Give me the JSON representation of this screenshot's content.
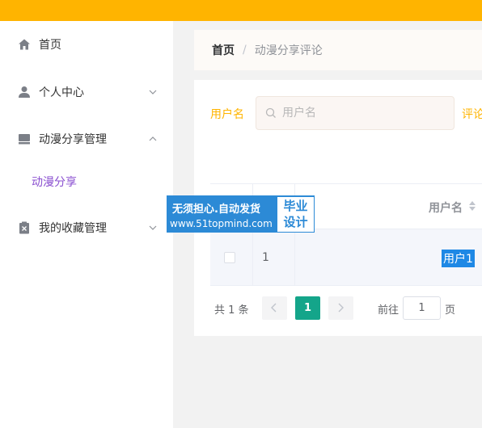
{
  "sidebar": {
    "items": [
      {
        "label": "首页",
        "icon": "home-icon"
      },
      {
        "label": "个人中心",
        "icon": "user-icon",
        "arrow": "chevron-down-icon"
      },
      {
        "label": "动漫分享管理",
        "icon": "inbox-icon",
        "arrow": "chevron-up-icon"
      },
      {
        "label": "我的收藏管理",
        "icon": "clipboard-icon",
        "arrow": "chevron-down-icon"
      }
    ],
    "submenu": {
      "label": "动漫分享"
    }
  },
  "breadcrumb": {
    "home": "首页",
    "separator": "/",
    "current": "动漫分享评论"
  },
  "filter": {
    "label": "用户名",
    "placeholder": "用户名",
    "next_label": "评论"
  },
  "table": {
    "header": {
      "username": "用户名"
    },
    "rows": [
      {
        "index": "1",
        "username": "用户1"
      }
    ]
  },
  "pagination": {
    "total": "共 1 条",
    "current_page": "1",
    "goto_label": "前往",
    "goto_value": "1",
    "page_suffix": "页"
  },
  "watermark": {
    "line1": "无须担心.自动发货",
    "line2": "www.51topmind.com",
    "box_line1": "毕业",
    "box_line2": "设计"
  },
  "colors": {
    "topbar": "#ffb400",
    "accent_label": "#ffb400",
    "submenu_active": "#8a4fd0",
    "pagination_active": "#14a58a",
    "watermark": "#2c8ad6",
    "selection": "#1e88e5"
  }
}
